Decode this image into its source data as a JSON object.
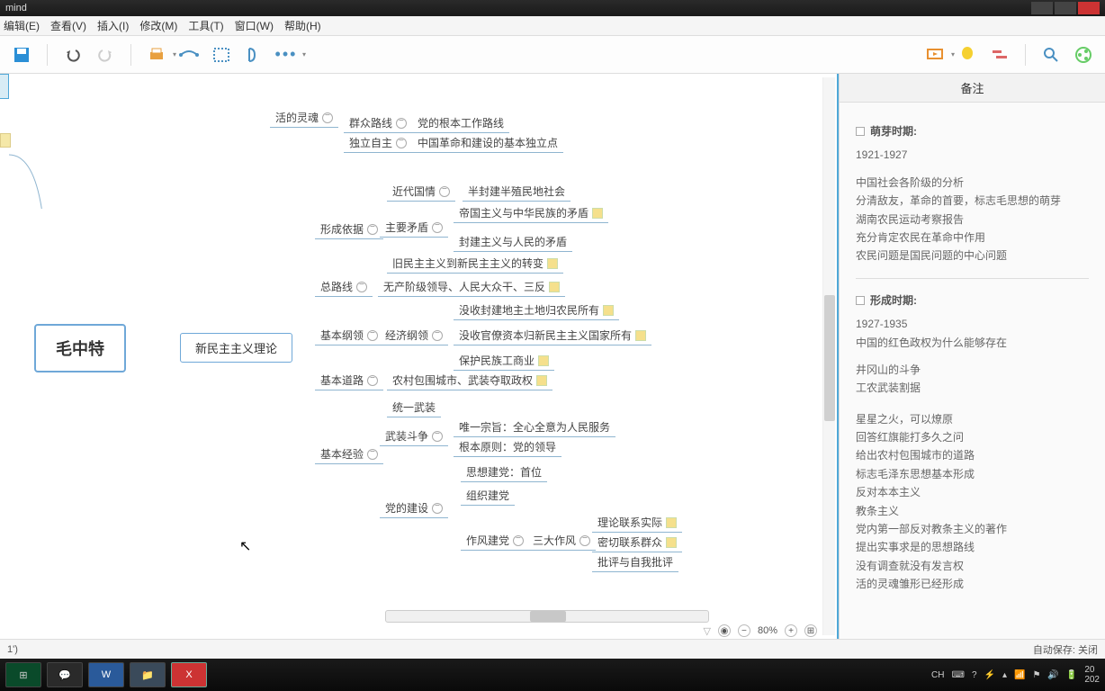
{
  "title": "mind",
  "menu": [
    "编辑(E)",
    "查看(V)",
    "插入(I)",
    "修改(M)",
    "工具(T)",
    "窗口(W)",
    "帮助(H)"
  ],
  "zoom": "80%",
  "status_left": "1')",
  "status_right": "自动保存: 关闭",
  "side_title": "备注",
  "notes": {
    "sec1_title": "萌芽时期:",
    "sec1_sub": "1921-1927",
    "sec1_lines": [
      "中国社会各阶级的分析",
      "分清敌友，革命的首要，标志毛思想的萌芽",
      "湖南农民运动考察报告",
      "充分肯定农民在革命中作用",
      "农民问题是国民问题的中心问题"
    ],
    "sec2_title": "形成时期:",
    "sec2_sub": "1927-1935",
    "sec2_sub2": "中国的红色政权为什么能够存在",
    "sec2_lines1": [
      "井冈山的斗争",
      "工农武装割据"
    ],
    "sec2_lines2": [
      "星星之火，可以燎原",
      "回答红旗能打多久之问",
      "给出农村包围城市的道路",
      "标志毛泽东思想基本形成",
      "反对本本主义",
      "教条主义",
      "党内第一部反对教条主义的著作",
      "提出实事求是的思想路线",
      "没有调查就没有发言权",
      "活的灵魂雏形已经形成"
    ]
  },
  "map": {
    "root": "毛中特",
    "topic": "新民主主义理论",
    "n_huoling": "活的灵魂",
    "n_qunzhong": "群众路线",
    "n_qunzhong_d": "党的根本工作路线",
    "n_duli": "独立自主",
    "n_duli_d": "中国革命和建设的基本独立点",
    "n_xingcheng": "形成依据",
    "n_jindai": "近代国情",
    "n_jindai_d": "半封建半殖民地社会",
    "n_zhuyao": "主要矛盾",
    "n_mao1": "帝国主义与中华民族的矛盾",
    "n_mao2": "封建主义与人民的矛盾",
    "n_jiuxin": "旧民主主义到新民主主义的转变",
    "n_zonglu": "总路线",
    "n_zonglu_d": "无产阶级领导、人民大众干、三反",
    "n_jiben": "基本纲领",
    "n_jingji": "经济纲领",
    "n_jj1": "没收封建地主土地归农民所有",
    "n_jj2": "没收官僚资本归新民主主义国家所有",
    "n_jj3": "保护民族工商业",
    "n_daolu": "基本道路",
    "n_daolu_d": "农村包围城市、武装夺取政权",
    "n_jingyan": "基本经验",
    "n_tongyi": "统一武装",
    "n_wuzhuang": "武装斗争",
    "n_wz1": "唯一宗旨：全心全意为人民服务",
    "n_wz2": "根本原则：党的领导",
    "n_sixiang": "思想建党：首位",
    "n_dangjian": "党的建设",
    "n_zuzhi": "组织建党",
    "n_zuofeng": "作风建党",
    "n_sanda": "三大作风",
    "n_sd1": "理论联系实际",
    "n_sd2": "密切联系群众",
    "n_sd3": "批评与自我批评"
  },
  "task_time": "20",
  "ime": "CH"
}
